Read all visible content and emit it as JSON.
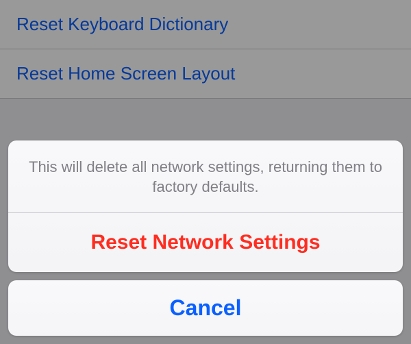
{
  "background": {
    "items": [
      {
        "label": "Reset Keyboard Dictionary"
      },
      {
        "label": "Reset Home Screen Layout"
      }
    ]
  },
  "action_sheet": {
    "message": "This will delete all network settings, returning them to factory defaults.",
    "destructive_label": "Reset Network Settings",
    "cancel_label": "Cancel"
  }
}
